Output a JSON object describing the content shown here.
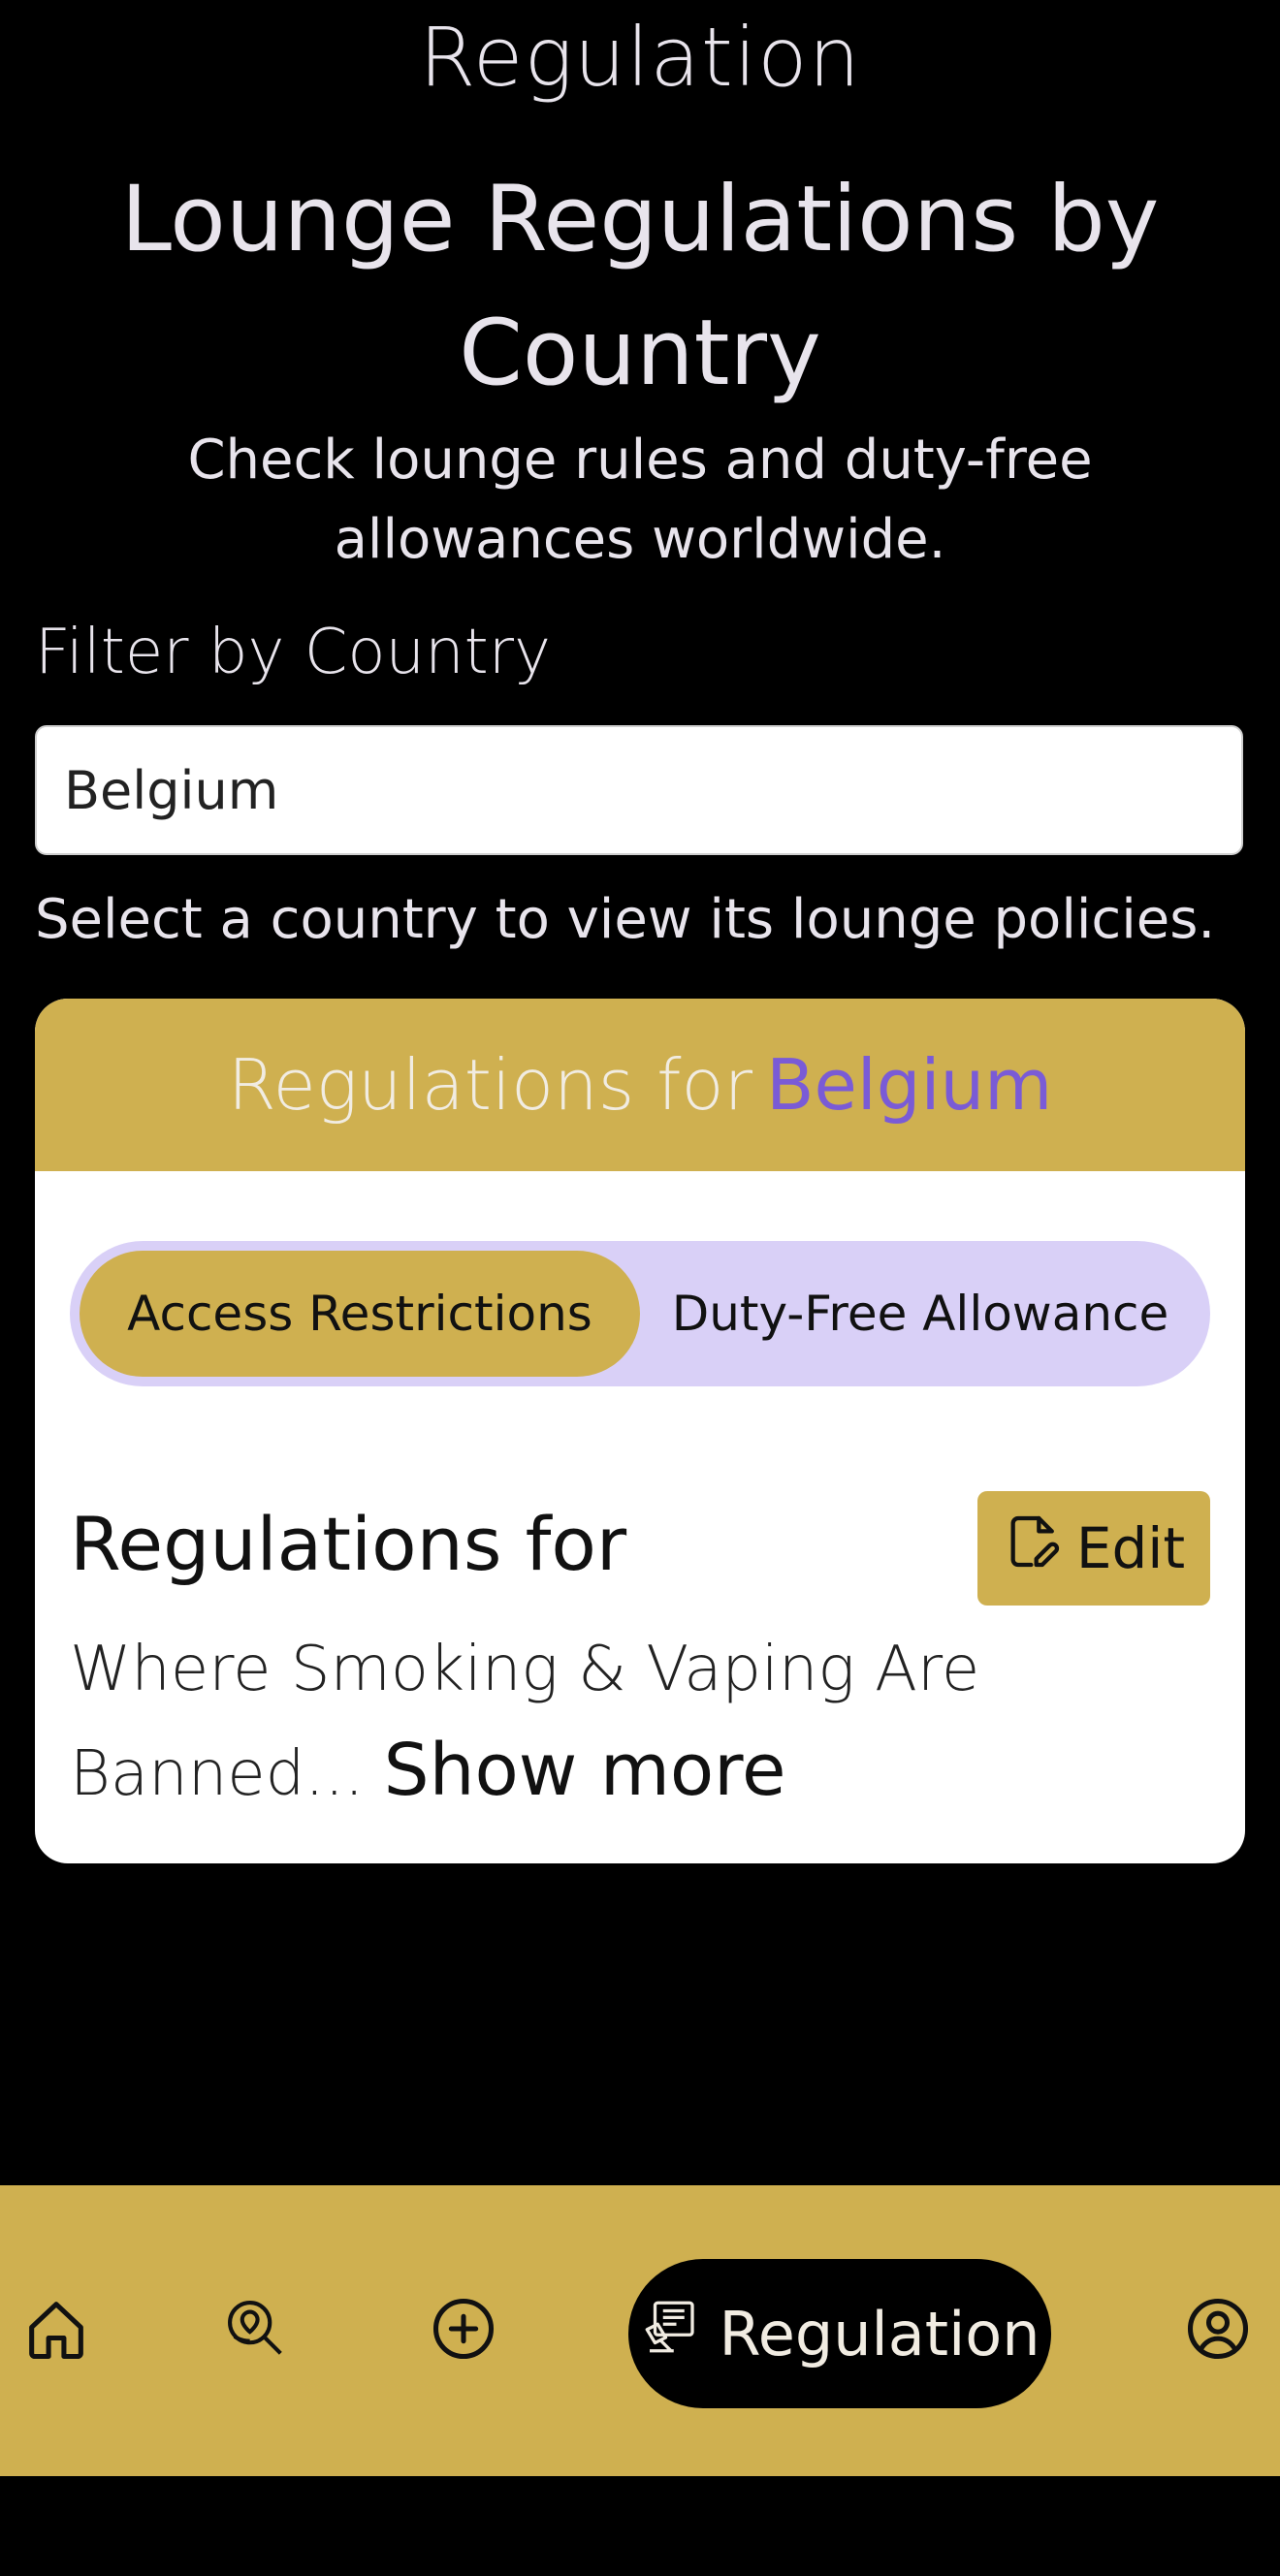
{
  "page": {
    "top_title": "Regulation",
    "heading": "Lounge Regulations by Country",
    "subheading": "Check lounge rules and duty-free allowances worldwide."
  },
  "filter": {
    "label": "Filter by Country",
    "value": "Belgium",
    "hint": "Select a country to view its lounge policies."
  },
  "card": {
    "header_prefix": "Regulations for",
    "header_country": "Belgium",
    "tabs": [
      {
        "label": "Access Restrictions",
        "active": true
      },
      {
        "label": "Duty-Free Allowance",
        "active": false
      }
    ],
    "section_title": "Regulations for",
    "edit_label": "Edit",
    "body_text": "Where Smoking & Vaping Are Banned...",
    "show_more": "Show more"
  },
  "nav": {
    "items": [
      {
        "icon": "home-icon"
      },
      {
        "icon": "map-search-icon"
      },
      {
        "icon": "add-circle-icon"
      },
      {
        "icon": "regulation-icon",
        "label": "Regulation",
        "active": true
      },
      {
        "icon": "profile-icon"
      }
    ]
  },
  "colors": {
    "accent_gold": "#cfb050",
    "accent_purple": "#7a5bd6",
    "tab_bg": "#d9d0f7",
    "background": "#000000"
  }
}
